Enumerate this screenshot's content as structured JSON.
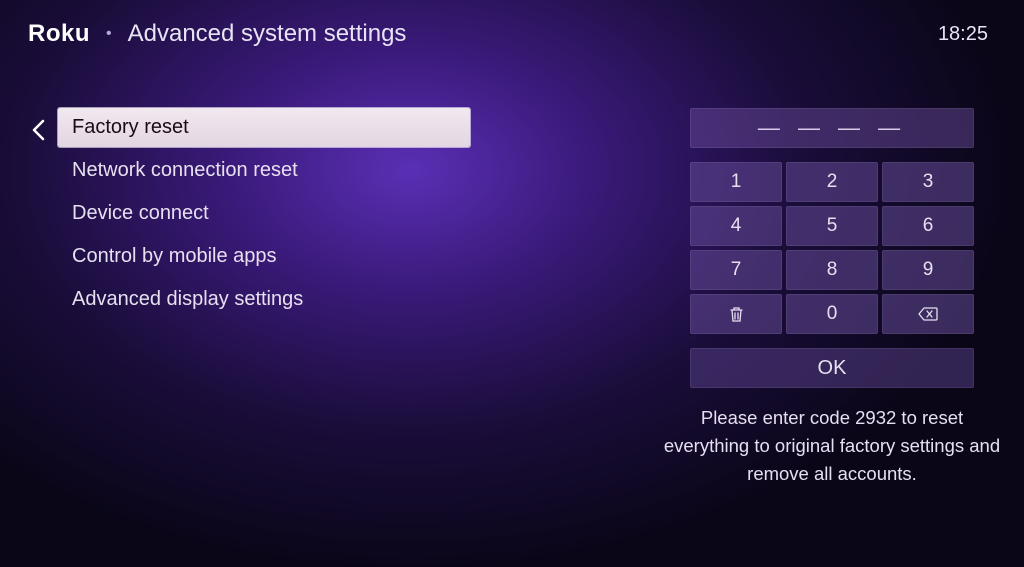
{
  "header": {
    "logo": "Roku",
    "title": "Advanced system settings",
    "clock": "18:25"
  },
  "menu": {
    "items": [
      {
        "label": "Factory reset",
        "selected": true
      },
      {
        "label": "Network connection reset",
        "selected": false
      },
      {
        "label": "Device connect",
        "selected": false
      },
      {
        "label": "Control by mobile apps",
        "selected": false
      },
      {
        "label": "Advanced display settings",
        "selected": false
      }
    ]
  },
  "keypad": {
    "code_display": "— — — —",
    "keys": [
      "1",
      "2",
      "3",
      "4",
      "5",
      "6",
      "7",
      "8",
      "9",
      "trash",
      "0",
      "backspace"
    ],
    "ok_label": "OK",
    "instruction": "Please enter code 2932 to reset everything to original factory settings and remove all accounts."
  }
}
